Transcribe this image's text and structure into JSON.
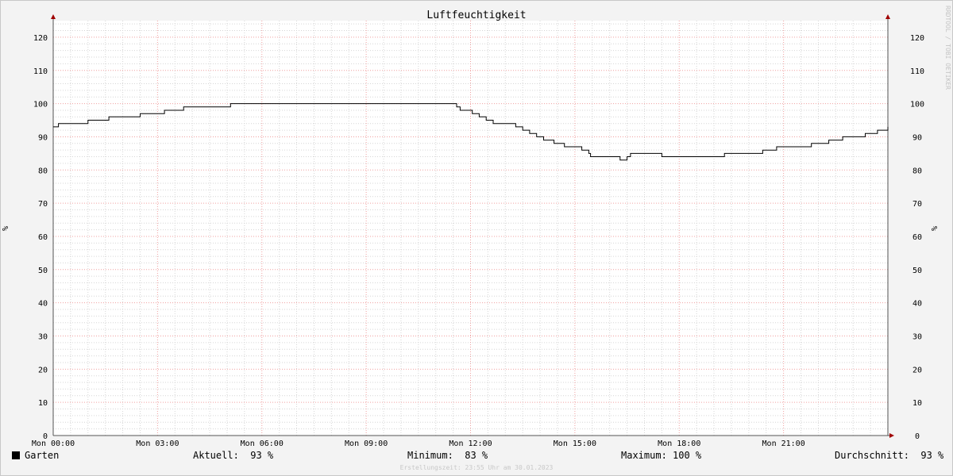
{
  "chart_data": {
    "type": "line",
    "title": "Luftfeuchtigkeit",
    "ylabel": "%",
    "y2label": "%",
    "watermark": "RRDTOOL / TOBI OETIKER",
    "ylim": [
      0,
      125
    ],
    "yticks": [
      0,
      10,
      20,
      30,
      40,
      50,
      60,
      70,
      80,
      90,
      100,
      110,
      120
    ],
    "xlim": [
      0,
      24
    ],
    "xticks": [
      {
        "x": 0,
        "label": "Mon 00:00"
      },
      {
        "x": 3,
        "label": "Mon 03:00"
      },
      {
        "x": 6,
        "label": "Mon 06:00"
      },
      {
        "x": 9,
        "label": "Mon 09:00"
      },
      {
        "x": 12,
        "label": "Mon 12:00"
      },
      {
        "x": 15,
        "label": "Mon 15:00"
      },
      {
        "x": 18,
        "label": "Mon 18:00"
      },
      {
        "x": 21,
        "label": "Mon 21:00"
      }
    ],
    "grid": true,
    "series": [
      {
        "name": "Garten",
        "color": "#000000",
        "step": true,
        "x": [
          0,
          0.15,
          1.0,
          1.6,
          2.5,
          3.2,
          3.75,
          4.3,
          4.7,
          5.1,
          11.6,
          11.7,
          11.8,
          12.05,
          12.25,
          12.45,
          12.65,
          13.3,
          13.5,
          13.7,
          13.9,
          14.1,
          14.4,
          14.7,
          15.2,
          15.3,
          15.4,
          15.45,
          15.8,
          16.3,
          16.5,
          16.6,
          17.5,
          19.3,
          20.4,
          20.8,
          21.2,
          21.8,
          22.3,
          22.7,
          23.35,
          23.7,
          24.0
        ],
        "values": [
          93,
          94,
          95,
          96,
          97,
          98,
          99,
          99,
          99,
          100,
          99,
          98,
          98,
          97,
          96,
          95,
          94,
          93,
          92,
          91,
          90,
          89,
          88,
          87,
          86,
          86,
          85,
          84,
          84,
          83,
          84,
          85,
          84,
          85,
          86,
          87,
          87,
          88,
          89,
          90,
          91,
          92,
          93
        ]
      }
    ]
  },
  "legend": {
    "series_label": "Garten",
    "series_color": "#000000",
    "current": "Aktuell:  93 %",
    "minimum": "Minimum:  83 %",
    "maximum": "Maximum: 100 %",
    "average": "Durchschnitt:  93 %"
  },
  "footer": {
    "created": "Erstellungszeit: 23:55 Uhr am 30.01.2023"
  }
}
